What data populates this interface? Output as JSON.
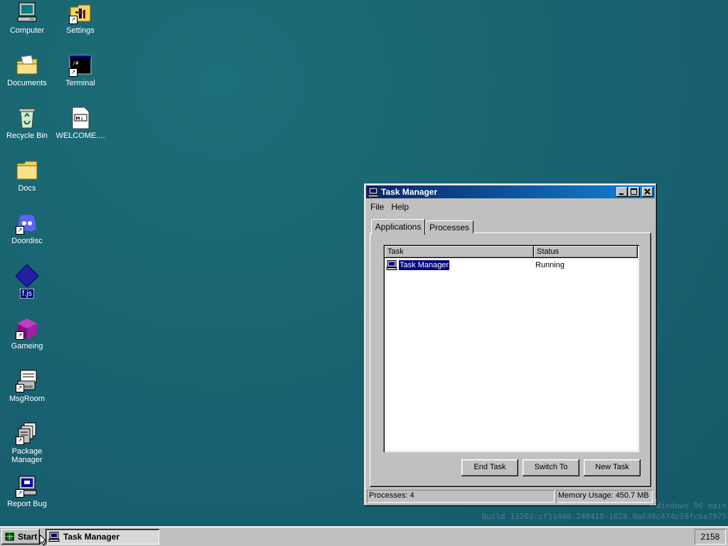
{
  "desktop": {
    "icons": [
      {
        "label": "Computer",
        "icon": "computer-icon"
      },
      {
        "label": "Settings",
        "icon": "settings-icon"
      },
      {
        "label": "Documents",
        "icon": "documents-folder-icon"
      },
      {
        "label": "Terminal",
        "icon": "terminal-icon"
      },
      {
        "label": "Recycle Bin",
        "icon": "recycle-bin-icon"
      },
      {
        "label": "WELCOME....",
        "icon": "markdown-file-icon"
      },
      {
        "label": "Docs",
        "icon": "folder-icon"
      },
      {
        "label": "Doordisc",
        "icon": "doordisc-icon"
      },
      {
        "label": "f.js",
        "icon": "js-file-icon"
      },
      {
        "label": "Gameing",
        "icon": "game-cube-icon"
      },
      {
        "label": "MsgRoom",
        "icon": "msgroom-icon"
      },
      {
        "label": "Package Manager",
        "icon": "package-manager-icon"
      },
      {
        "label": "Report Bug",
        "icon": "report-bug-icon"
      }
    ],
    "watermark": {
      "line1": "Windows 96 main",
      "line2": "Build 13202.cf11446.240410-1828.0a630c474c19fc6a7975"
    }
  },
  "window": {
    "title": "Task Manager",
    "menu": [
      "File",
      "Help"
    ],
    "tabs": [
      "Applications",
      "Processes"
    ],
    "active_tab": "Applications",
    "columns": [
      "Task",
      "Status"
    ],
    "rows": [
      {
        "task": "Task Manager",
        "status": "Running"
      }
    ],
    "buttons": {
      "end_task": "End Task",
      "switch_to": "Switch To",
      "new_task": "New Task"
    },
    "status": {
      "processes": "Processes: 4",
      "memory": "Memory Usage: 450.7 MB"
    }
  },
  "taskbar": {
    "start_label": "Start",
    "task_label": "Task Manager",
    "clock": "2158"
  }
}
